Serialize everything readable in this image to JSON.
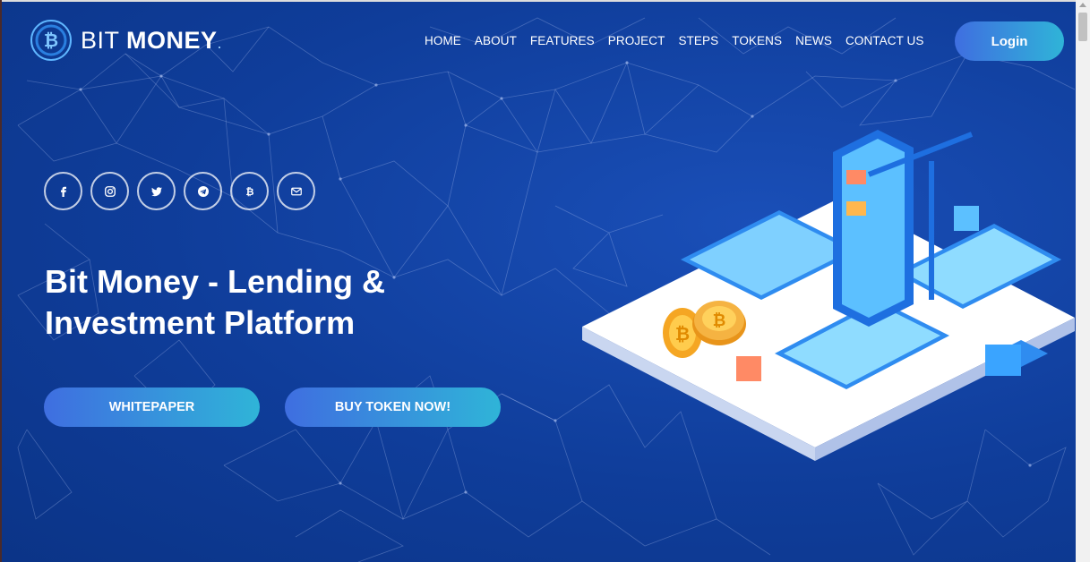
{
  "brand": {
    "name_light": "BIT",
    "name_bold": "MONEY",
    "trademark": "."
  },
  "nav": {
    "items": [
      "HOME",
      "ABOUT",
      "FEATURES",
      "PROJECT",
      "STEPS",
      "TOKENS",
      "NEWS",
      "CONTACT US"
    ]
  },
  "header": {
    "login_label": "Login"
  },
  "social": {
    "icons": [
      "facebook-icon",
      "instagram-icon",
      "twitter-icon",
      "telegram-icon",
      "bitcoin-icon",
      "mail-icon"
    ]
  },
  "hero": {
    "title_line1": "Bit Money - Lending &",
    "title_line2": "Investment Platform",
    "whitepaper_label": "WHITEPAPER",
    "buy_label": "BUY TOKEN NOW!"
  },
  "colors": {
    "background": "#0f3d9a",
    "button_gradient_start": "#3f6ee0",
    "button_gradient_end": "#2fb4d8"
  }
}
